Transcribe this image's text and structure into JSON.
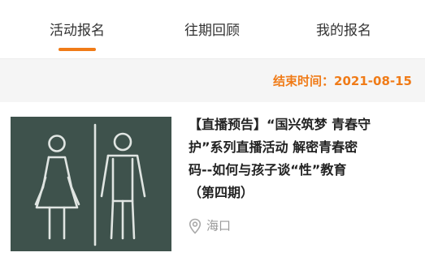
{
  "tabs": [
    {
      "label": "活动报名",
      "active": true
    },
    {
      "label": "往期回顾",
      "active": false
    },
    {
      "label": "我的报名",
      "active": false
    }
  ],
  "colors": {
    "accent": "#f07b17",
    "text_primary": "#222222",
    "text_secondary": "#999999",
    "thumb_bg": "#3e524c"
  },
  "end_time_text": "结束时间：2021-08-15",
  "event": {
    "title_lines": [
      "【直播预告】“国兴筑梦 青春守",
      "护”系列直播活动 解密青春密",
      "码--如何与孩子谈“性”教育",
      "（第四期）"
    ],
    "location": "海口",
    "location_icon": "location-pin-icon",
    "image_subject": "chalk-drawing-woman-and-man"
  }
}
